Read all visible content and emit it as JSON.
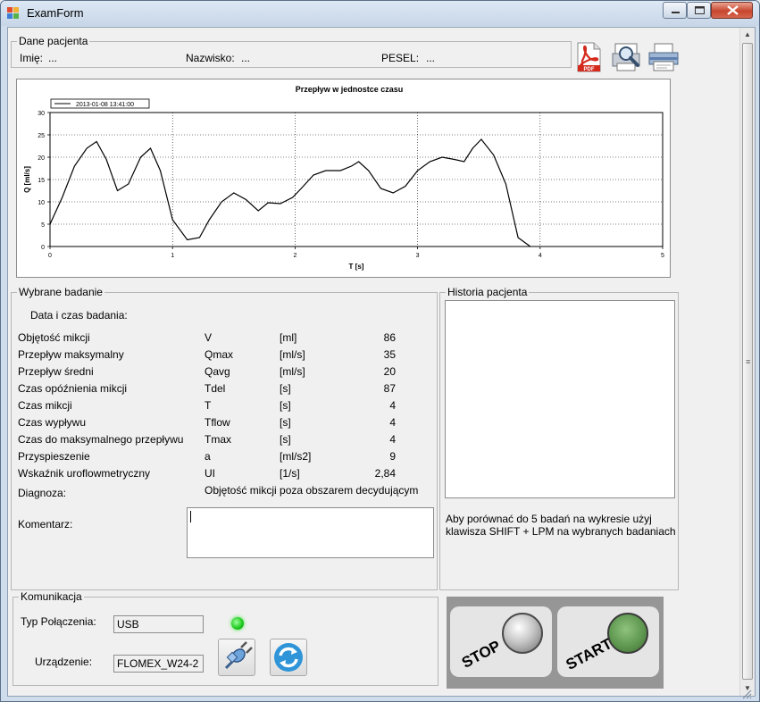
{
  "window": {
    "title": "ExamForm"
  },
  "patient": {
    "group_title": "Dane pacjenta",
    "first_name_label": "Imię:",
    "first_name_value": "...",
    "last_name_label": "Nazwisko:",
    "last_name_value": "...",
    "pesel_label": "PESEL:",
    "pesel_value": "..."
  },
  "toolbar": {
    "icons": [
      "pdf-icon",
      "print-preview-icon",
      "printer-icon"
    ]
  },
  "chart_data": {
    "type": "line",
    "title": "Przepływ w jednostce czasu",
    "xlabel": "T [s]",
    "ylabel": "Q [ml/s]",
    "xlim": [
      0,
      5
    ],
    "ylim": [
      0,
      30
    ],
    "xticks": [
      "0",
      "1",
      "2",
      "3",
      "4",
      "5"
    ],
    "yticks": [
      "0",
      "5",
      "10",
      "15",
      "20",
      "25",
      "30"
    ],
    "grid": "dotted",
    "legend_position": "top-left",
    "series": [
      {
        "name": "2013-01-08  13:41:00",
        "color": "#000000",
        "x": [
          0.0,
          0.1,
          0.2,
          0.3,
          0.38,
          0.46,
          0.55,
          0.64,
          0.74,
          0.82,
          0.9,
          1.0,
          1.12,
          1.22,
          1.3,
          1.4,
          1.5,
          1.6,
          1.7,
          1.78,
          1.88,
          1.98,
          2.05,
          2.15,
          2.25,
          2.37,
          2.46,
          2.52,
          2.6,
          2.7,
          2.8,
          2.9,
          3.0,
          3.1,
          3.2,
          3.3,
          3.38,
          3.45,
          3.52,
          3.62,
          3.72,
          3.82,
          3.92
        ],
        "y": [
          5,
          11,
          18,
          22,
          23.5,
          19.5,
          12.5,
          14,
          20,
          22,
          17,
          6,
          1.5,
          2,
          6,
          10,
          12,
          10.5,
          8,
          9.8,
          9.6,
          11,
          13,
          16,
          17,
          17,
          18,
          19,
          17,
          13,
          12,
          13.5,
          17,
          19,
          20,
          19.5,
          19,
          22,
          24,
          20.5,
          14,
          2,
          0
        ]
      }
    ]
  },
  "exam": {
    "group_title": "Wybrane badanie",
    "date_label": "Data i czas badania:",
    "rows": [
      {
        "name": "Objętość mikcji",
        "symbol": "V",
        "unit": "[ml]",
        "value": "86"
      },
      {
        "name": "Przepływ maksymalny",
        "symbol": "Qmax",
        "unit": "[ml/s]",
        "value": "35"
      },
      {
        "name": "Przepływ średni",
        "symbol": "Qavg",
        "unit": "[ml/s]",
        "value": "20"
      },
      {
        "name": "Czas opóźnienia mikcji",
        "symbol": "Tdel",
        "unit": "[s]",
        "value": "87"
      },
      {
        "name": "Czas mikcji",
        "symbol": "T",
        "unit": "[s]",
        "value": "4"
      },
      {
        "name": "Czas wypływu",
        "symbol": "Tflow",
        "unit": "[s]",
        "value": "4"
      },
      {
        "name": "Czas do maksymalnego przepływu",
        "symbol": "Tmax",
        "unit": "[s]",
        "value": "4"
      },
      {
        "name": "Przyspieszenie",
        "symbol": "a",
        "unit": "[ml/s2]",
        "value": "9"
      },
      {
        "name": "Wskaźnik uroflowmetryczny",
        "symbol": "UI",
        "unit": "[1/s]",
        "value": "2,84"
      }
    ],
    "diagnosis_label": "Diagnoza:",
    "diagnosis_value": "Objętość mikcji poza obszarem decydującym",
    "comment_label": "Komentarz:",
    "comment_value": ""
  },
  "history": {
    "group_title": "Historia pacjenta",
    "hint": "Aby porównać do 5 badań na wykresie użyj klawisza SHIFT + LPM na wybranych badaniach"
  },
  "communication": {
    "group_title": "Komunikacja",
    "connection_label": "Typ Połączenia:",
    "connection_value": "USB",
    "device_label": "Urządzenie:",
    "device_value": "FLOMEX_W24-2",
    "status_color": "#19c619"
  },
  "controls": {
    "stop_label": "STOP",
    "start_label": "START"
  }
}
